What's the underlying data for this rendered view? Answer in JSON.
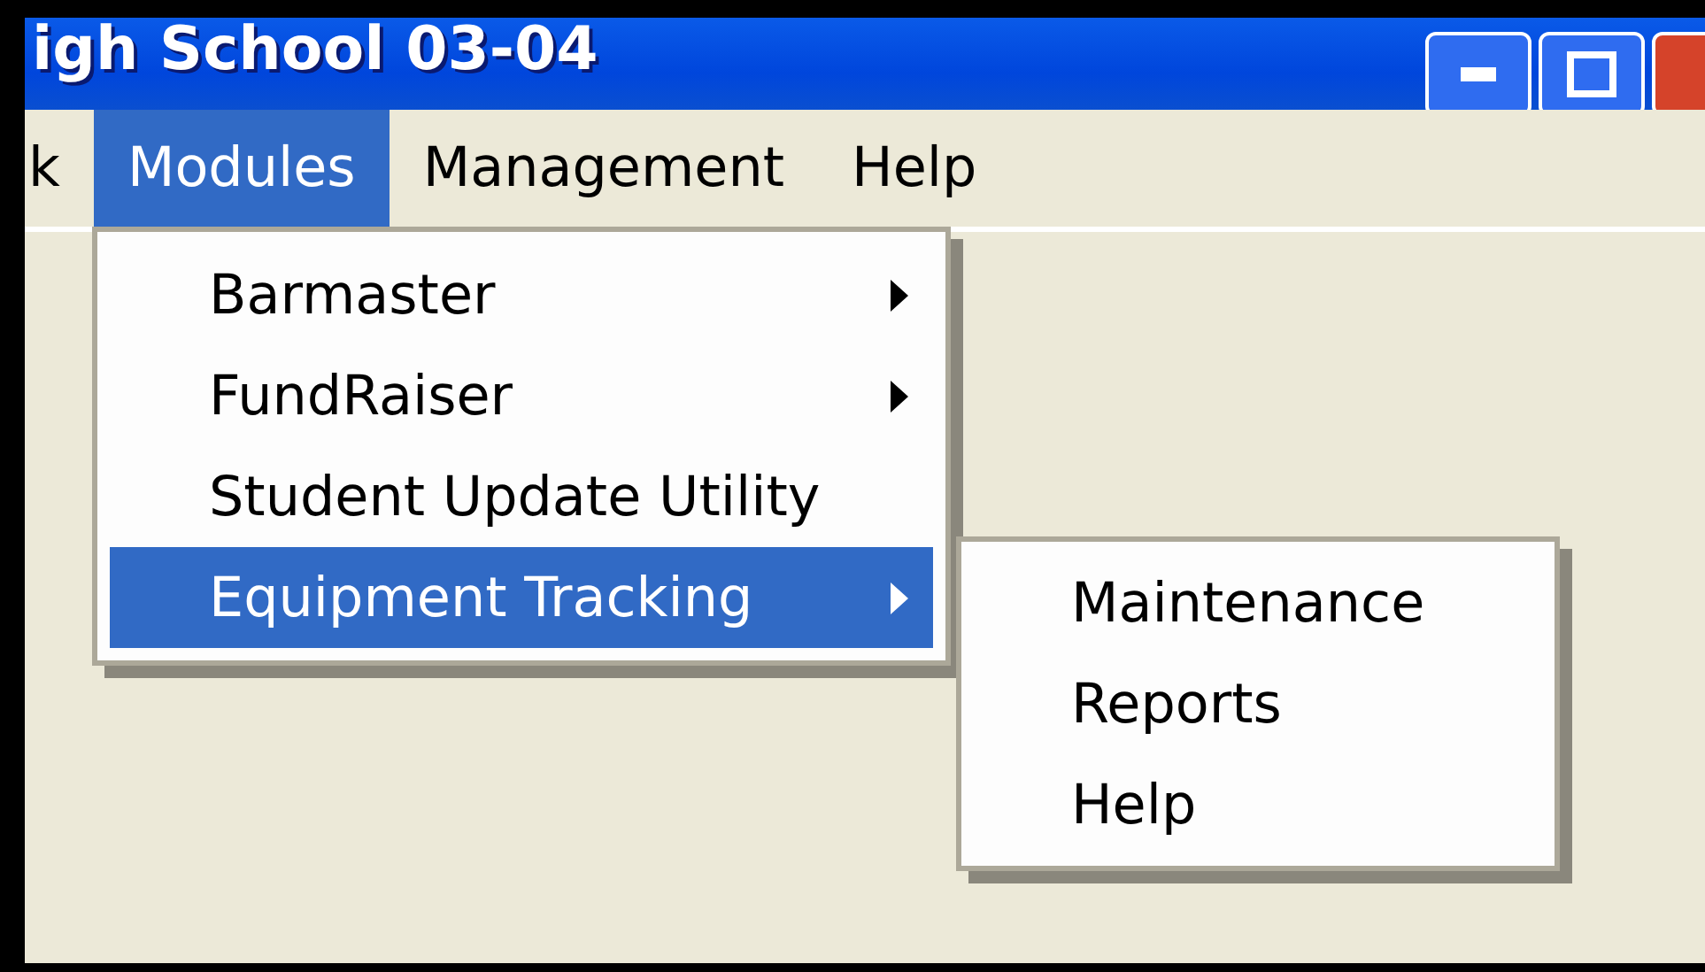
{
  "window": {
    "title": "igh School 03-04"
  },
  "menubar": [
    {
      "label": "k",
      "selected": false
    },
    {
      "label": "Modules",
      "selected": true
    },
    {
      "label": "Management",
      "selected": false
    },
    {
      "label": "Help",
      "selected": false
    }
  ],
  "menu": [
    {
      "label": "Barmaster",
      "has_submenu": true,
      "selected": false
    },
    {
      "label": "FundRaiser",
      "has_submenu": true,
      "selected": false
    },
    {
      "label": "Student Update Utility",
      "has_submenu": false,
      "selected": false
    },
    {
      "label": "Equipment Tracking",
      "has_submenu": true,
      "selected": true
    }
  ],
  "submenu": [
    {
      "label": "Maintenance"
    },
    {
      "label": "Reports"
    },
    {
      "label": "Help"
    }
  ]
}
